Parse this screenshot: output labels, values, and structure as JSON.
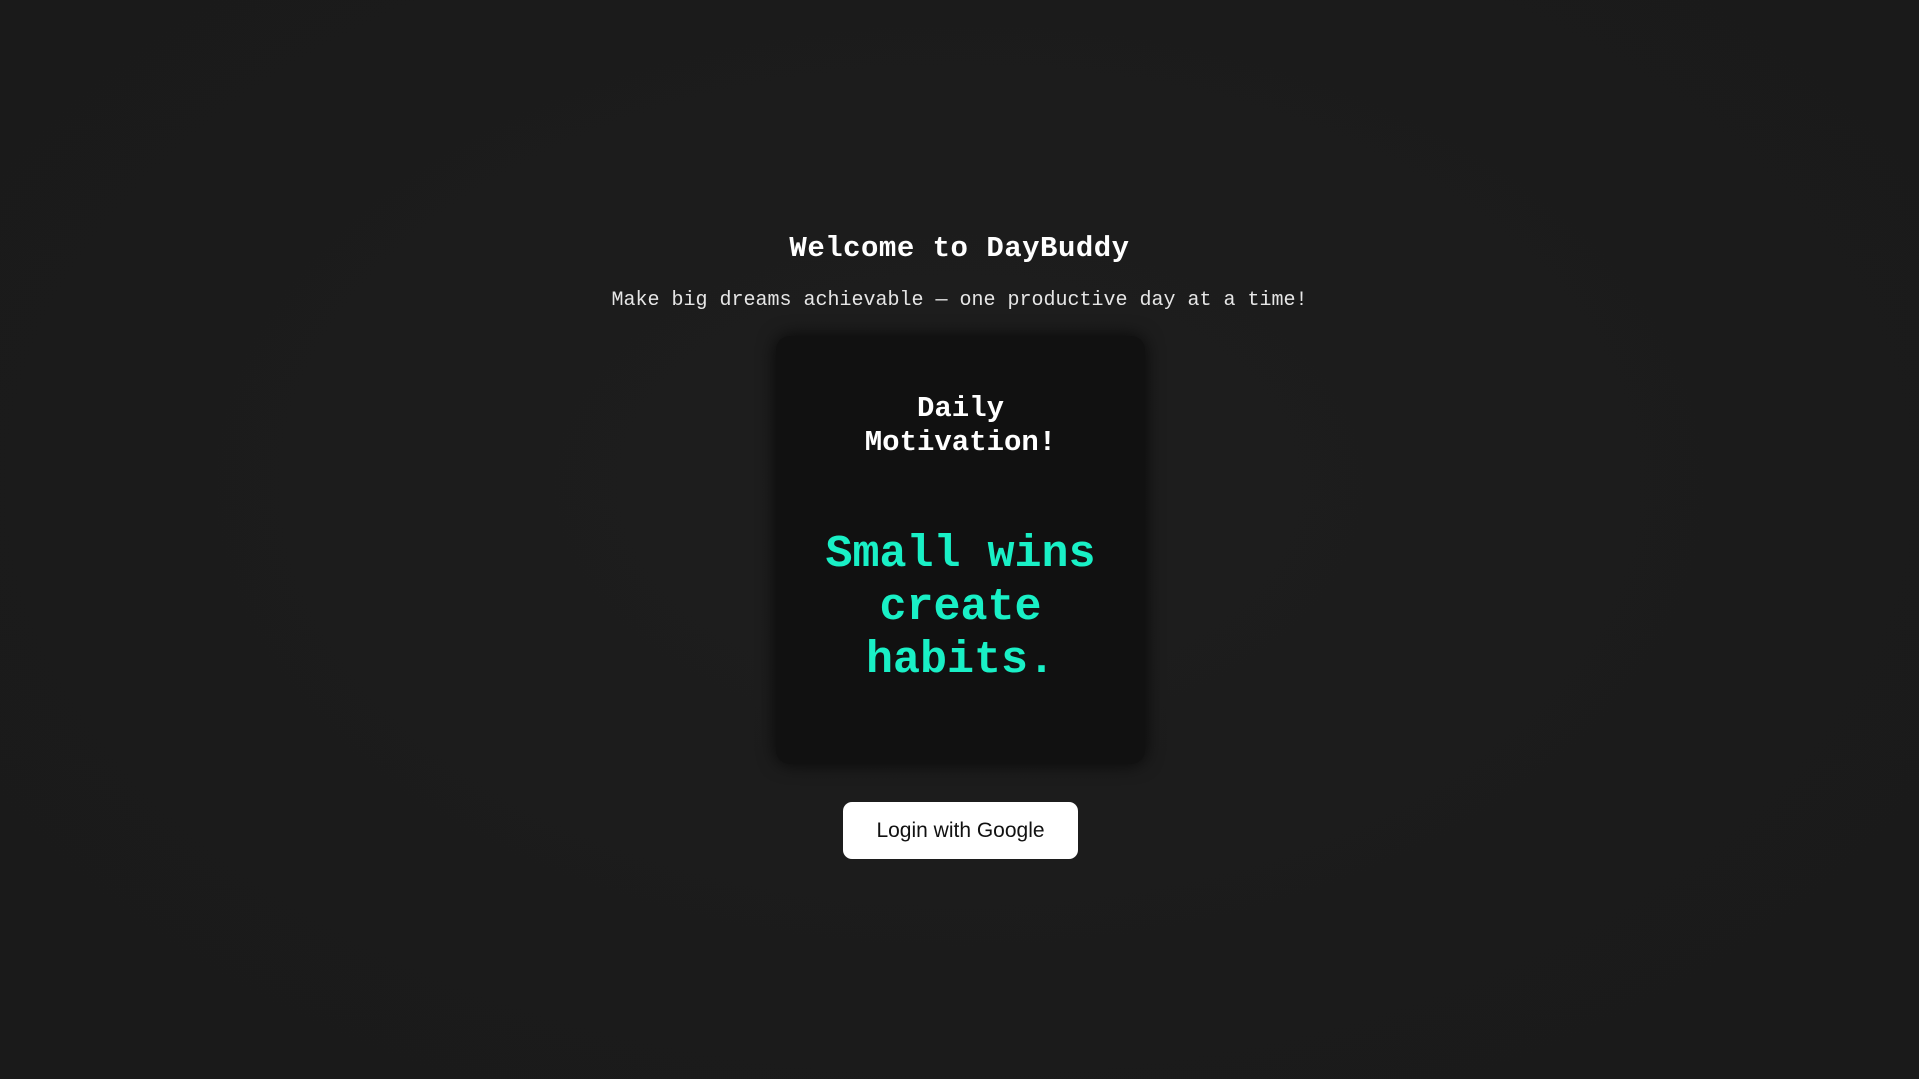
{
  "header": {
    "title": "Welcome to DayBuddy",
    "subtitle": "Make big dreams achievable — one productive day at a time!"
  },
  "motivation_card": {
    "heading": "Daily Motivation!",
    "quote": "Small wins create habits."
  },
  "auth": {
    "login_label": "Login with Google"
  },
  "colors": {
    "background": "#1b1b1b",
    "card_background": "#111111",
    "accent": "#19f0c6",
    "button_background": "#ffffff"
  }
}
